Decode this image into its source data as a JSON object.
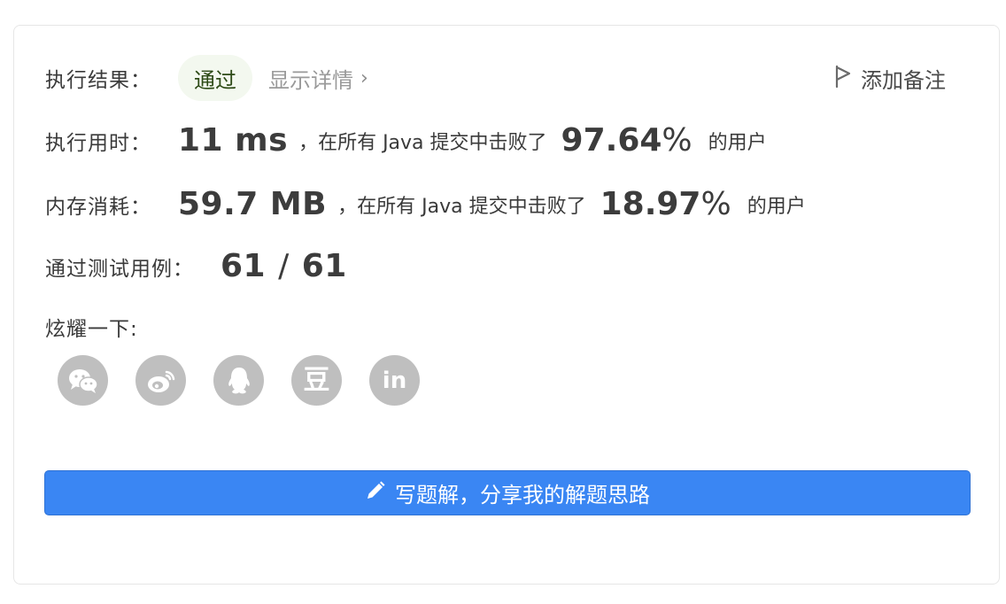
{
  "result": {
    "label": "执行结果：",
    "status": "通过",
    "detail_link": "显示详情",
    "add_note": "添加备注"
  },
  "runtime": {
    "label": "执行用时：",
    "value": "11 ms",
    "middle_text": "，在所有 Java 提交中击败了",
    "percent": "97.64",
    "percent_sign": "%",
    "suffix": "的用户"
  },
  "memory": {
    "label": "内存消耗：",
    "value": "59.7 MB",
    "middle_text": "，在所有 Java 提交中击败了",
    "percent": "18.97",
    "percent_sign": "%",
    "suffix": "的用户"
  },
  "testcases": {
    "label": "通过测试用例：",
    "passed": "61",
    "separator": "/",
    "total": "61"
  },
  "share": {
    "label": "炫耀一下:",
    "icons": [
      "wechat-icon",
      "weibo-icon",
      "qq-icon",
      "douban-icon",
      "linkedin-icon"
    ],
    "douban_glyph": "豆",
    "linkedin_glyph": "in"
  },
  "write_button": {
    "label": "写题解，分享我的解题思路"
  },
  "colors": {
    "primary_button": "#3a86f3",
    "success_badge_bg": "#f3f8ef",
    "social_icon_bg": "#bfbfbf"
  }
}
